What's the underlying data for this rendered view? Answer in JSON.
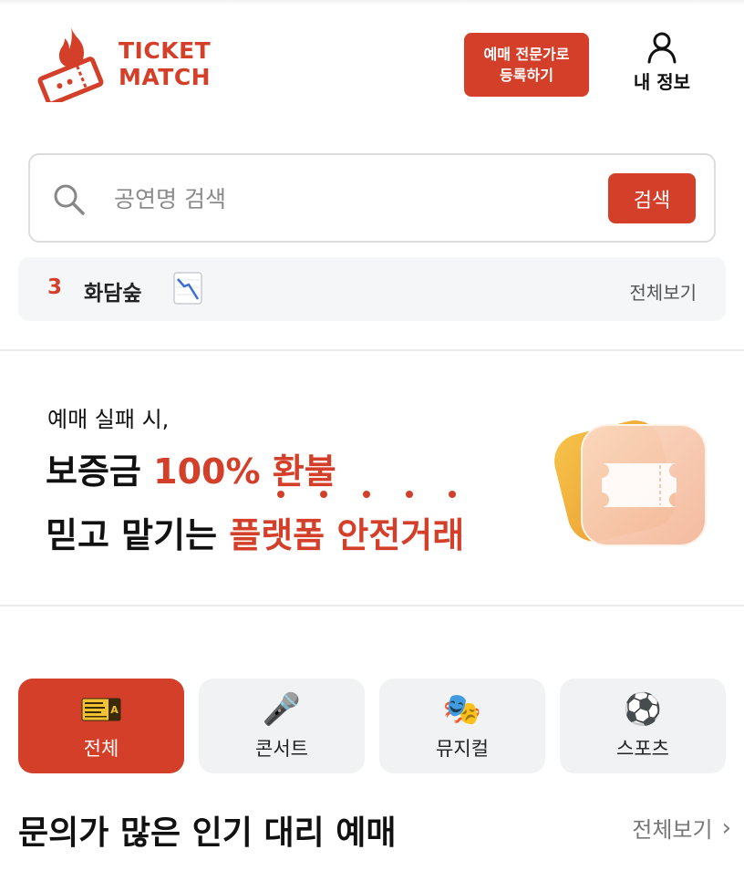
{
  "header": {
    "logo_line1": "TICKET",
    "logo_line2": "MATCH",
    "pro_btn_line1": "예매 전문가로",
    "pro_btn_line2": "등록하기",
    "myinfo_label": "내 정보"
  },
  "search": {
    "placeholder": "공연명 검색",
    "button_label": "검색"
  },
  "trending": {
    "rank": "3",
    "name": "화담숲",
    "trend_icon": "chart-decreasing-icon",
    "view_all": "전체보기"
  },
  "banner": {
    "line1": "예매 실패 시,",
    "line2_pre": "보증금 ",
    "line2_red": "100% 환불",
    "line3_pre": "믿고 맡기는 ",
    "line3_red": "플랫폼 안전거래"
  },
  "categories": [
    {
      "label": "전체",
      "icon": "ticket-icon",
      "active": true
    },
    {
      "label": "콘서트",
      "icon": "🎤",
      "active": false
    },
    {
      "label": "뮤지컬",
      "icon": "🎭",
      "active": false
    },
    {
      "label": "스포츠",
      "icon": "⚽",
      "active": false
    }
  ],
  "section": {
    "title": "문의가 많은 인기 대리 예매",
    "view_all": "전체보기"
  },
  "colors": {
    "brand": "#d43f2a",
    "surface": "#f5f6f8"
  }
}
